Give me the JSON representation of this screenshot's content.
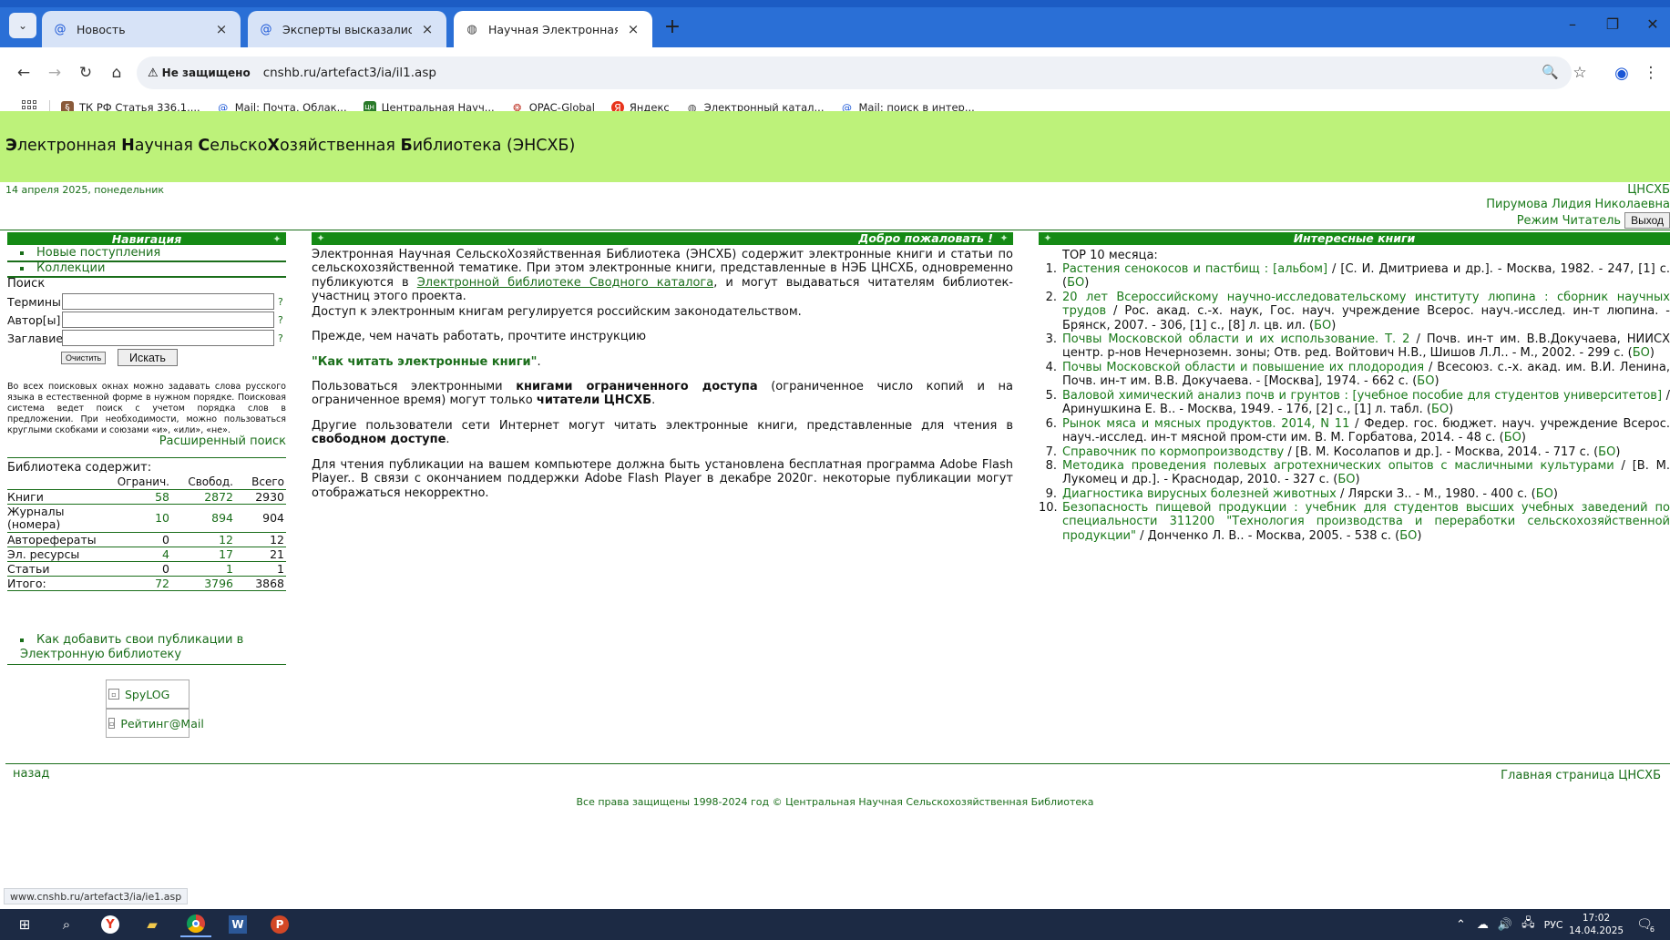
{
  "browser": {
    "tabs": [
      {
        "label": "Новость",
        "icon": "at-icon"
      },
      {
        "label": "Эксперты высказались о возм",
        "icon": "at-icon"
      },
      {
        "label": "Научная Электронная Библио",
        "icon": "globe-icon"
      }
    ],
    "address": {
      "security_label": "Не защищено",
      "url": "cnshb.ru/artefact3/ia/il1.asp"
    },
    "bookmarks": [
      {
        "label": "ТК РФ Статья 336.1...."
      },
      {
        "label": "Mail: Почта, Облак..."
      },
      {
        "label": "Центральная Науч..."
      },
      {
        "label": "OPAC-Global"
      },
      {
        "label": "Яндекс"
      },
      {
        "label": "Электронный катал..."
      },
      {
        "label": "Mail: поиск в интер..."
      }
    ],
    "status_url": "www.cnshb.ru/artefact3/ia/ie1.asp"
  },
  "site": {
    "title_parts": [
      "Э",
      "лектронная ",
      "Н",
      "аучная ",
      "С",
      "ельско",
      "Х",
      "озяйственная ",
      "Б",
      "иблиотека (ЭНСХБ)"
    ],
    "date": "14 апреля 2025, понедельник",
    "org": "ЦНСХБ",
    "user": "Пирумова Лидия Николаевна",
    "mode": "Режим Читатель",
    "exit_label": "Выход"
  },
  "nav": {
    "heading": "Навигация",
    "links": [
      "Новые поступления",
      "Коллекции"
    ]
  },
  "search": {
    "title": "Поиск",
    "fields": [
      {
        "label": "Термины",
        "value": ""
      },
      {
        "label": "Автор[ы]",
        "value": ""
      },
      {
        "label": "Заглавие",
        "value": ""
      }
    ],
    "help_mark": "?",
    "clear_label": "Очистить",
    "search_label": "Искать",
    "help_text": "Во всех поисковых окнах можно задавать слова русского языка в естественной форме в нужном порядке. Поисковая система ведет поиск с учетом порядка слов в предложении. При необходимости, можно пользоваться круглыми скобками и союзами «и», «или», «не».",
    "advanced_label": "Расширенный поиск"
  },
  "stats": {
    "title": "Библиотека содержит:",
    "columns": [
      "Огранич.",
      "Свобод.",
      "Всего"
    ],
    "rows": [
      {
        "label": "Книги",
        "restricted": "58",
        "free": "2872",
        "total": "2930"
      },
      {
        "label": "Журналы (номера)",
        "restricted": "10",
        "free": "894",
        "total": "904"
      },
      {
        "label": "Авторефераты",
        "restricted": "0",
        "free": "12",
        "total": "12"
      },
      {
        "label": "Эл. ресурсы",
        "restricted": "4",
        "free": "17",
        "total": "21"
      },
      {
        "label": "Статьи",
        "restricted": "0",
        "free": "1",
        "total": "1"
      },
      {
        "label": "Итого:",
        "restricted": "72",
        "free": "3796",
        "total": "3868"
      }
    ],
    "add_link": "Как добавить свои публикации в Электронную библиотеку"
  },
  "counters": [
    "SpyLOG",
    "Рейтинг@Mail"
  ],
  "welcome": {
    "heading": "Добро пожаловать !",
    "p1_a": "Электронная Научная СельскоХозяйственная Библиотека (ЭНСХБ) содержит электронные книги и статьи по сельскохозяйственной тематике. При этом электронные книги, представленные в НЭБ ЦНСХБ, одновременно публикуются в ",
    "p1_link": "Электронной библиотеке Сводного каталога",
    "p1_b": ", и могут выдаваться читателям библиотек-участниц этого проекта.",
    "p2": "Доступ к электронным книгам регулируется российским законодательством.",
    "p3": "Прежде, чем начать работать, прочтите инструкцию",
    "p4": "\"Как читать электронные книги\"",
    "p4_end": ".",
    "p5_a": "Пользоваться электронными ",
    "p5_b1": "книгами ограниченного доступа",
    "p5_c": " (ограниченное число копий и на ограниченное время) могут только ",
    "p5_b2": "читатели ЦНСХБ",
    "p5_end": ".",
    "p6_a": "Другие пользователи сети Интернет могут читать электронные книги, представленные для чтения в ",
    "p6_b": "свободном доступе",
    "p6_end": ".",
    "p7": "Для чтения публикации на вашем компьютере должна быть установлена бесплатная программа Adobe Flash Player.. В связи с окончанием поддержки Adobe Flash Player в декабре 2020г. некоторые публикации могут отображаться некорректно."
  },
  "interesting": {
    "heading": "Интересные книги",
    "top_title": "ТОР 10 месяца:",
    "bo": "БО",
    "items": [
      {
        "num": "1.",
        "title": "Растения сенокосов и пастбищ : [альбом]",
        "rest": " / [С. И. Дмитриева и др.]. - Москва, 1982. - 247, [1] с."
      },
      {
        "num": "2.",
        "title": "20 лет Всероссийскому научно-исследовательскому институту люпина : сборник научных трудов",
        "rest": " / Рос. акад. с.-х. наук, Гос. науч. учреждение Всерос. науч.-исслед. ин-т люпина. - Брянск, 2007. - 306, [1] с., [8] л. цв. ил."
      },
      {
        "num": "3.",
        "title": "Почвы Московской области и их использование. Т. 2",
        "rest": " / Почв. ин-т им. В.В.Докучаева, НИИСХ центр. р-нов Нечерноземн. зоны; Отв. ред. Войтович Н.В., Шишов Л.Л.. - М., 2002. - 299 с."
      },
      {
        "num": "4.",
        "title": "Почвы Московской области и повышение их плодородия",
        "rest": " / Всесоюз. с.-х. акад. им. В.И. Ленина, Почв. ин-т им. В.В. Докучаева. - [Москва], 1974. - 662 с."
      },
      {
        "num": "5.",
        "title": "Валовой химический анализ почв и грунтов : [учебное пособие для студентов университетов]",
        "rest": " / Аринушкина Е. В.. - Москва, 1949. - 176, [2] с., [1] л. табл."
      },
      {
        "num": "6.",
        "title": "Рынок мяса и мясных продуктов. 2014, N 11",
        "rest": " / Федер. гос. бюджет. науч. учреждение Всерос. науч.-исслед. ин-т мясной пром-сти им. В. М. Горбатова, 2014. - 48 с."
      },
      {
        "num": "7.",
        "title": "Справочник по кормопроизводству",
        "rest": " / [В. М. Косолапов и др.]. - Москва, 2014. - 717 с."
      },
      {
        "num": "8.",
        "title": "Методика проведения полевых агротехнических опытов с масличными культурами",
        "rest": " / [В. М. Лукомец и др.]. - Краснодар, 2010. - 327 с."
      },
      {
        "num": "9.",
        "title": "Диагностика вирусных болезней животных",
        "rest": " / Лярски З.. - М., 1980. - 400 с."
      },
      {
        "num": "10.",
        "title": "Безопасность пищевой продукции : учебник для студентов высших учебных заведений по специальности 311200 \"Технология производства и переработки сельскохозяйственной продукции\"",
        "rest": " / Донченко Л. В.. - Москва, 2005. - 538 с."
      }
    ]
  },
  "footer": {
    "back_label": "назад",
    "home_label": "Главная страница ЦНСХБ",
    "copyright": "Все права защищены 1998-2024 год © Центральная Научная Сельскохозяйственная Библиотека"
  },
  "taskbar": {
    "lang": "РУС",
    "time": "17:02",
    "date": "14.04.2025",
    "notif_count": "6"
  },
  "colors": {
    "header_green": "#bdf27a",
    "panel_green": "#158a15",
    "link_green": "#1a7a1a",
    "chrome_blue": "#2a6fd6"
  }
}
